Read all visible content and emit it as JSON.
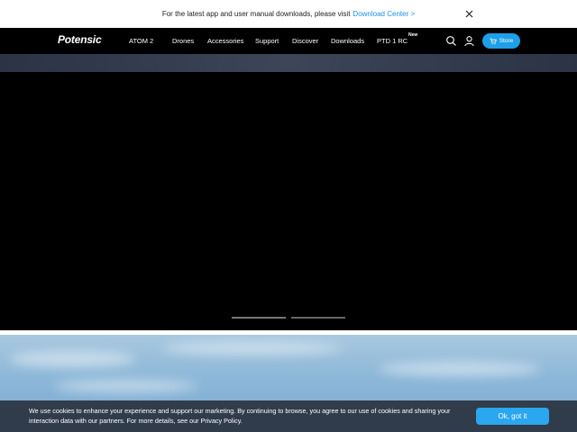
{
  "announcement": {
    "text": "For the latest app and user manual downloads, please visit",
    "link_label": "Download Center",
    "link_arrow": ">",
    "close_icon": "close-icon"
  },
  "nav": {
    "logo": "Potensic",
    "items": [
      {
        "label": "ATOM 2"
      },
      {
        "label": "Drones"
      },
      {
        "label": "Accessories"
      },
      {
        "label": "Support"
      },
      {
        "label": "Discover"
      },
      {
        "label": "Downloads"
      },
      {
        "label": "PTD 1 RC"
      }
    ],
    "new_badge": "New",
    "search_icon": "search-icon",
    "account_icon": "user-icon",
    "store_label": "Store",
    "store_icon": "cart-icon"
  },
  "hero": {
    "slides": 2,
    "active_slide": 1
  },
  "cookie": {
    "text": "We use cookies to enhance your experience and support our marketing. By continuing to browse, you agree to our use of cookies and sharing your interaction data with our partners. For more details, see our Privacy Policy.",
    "button_label": "Ok, got it"
  },
  "colors": {
    "accent": "#1ea0e8",
    "nav_bg": "#000000",
    "link": "#1a8fe0"
  }
}
